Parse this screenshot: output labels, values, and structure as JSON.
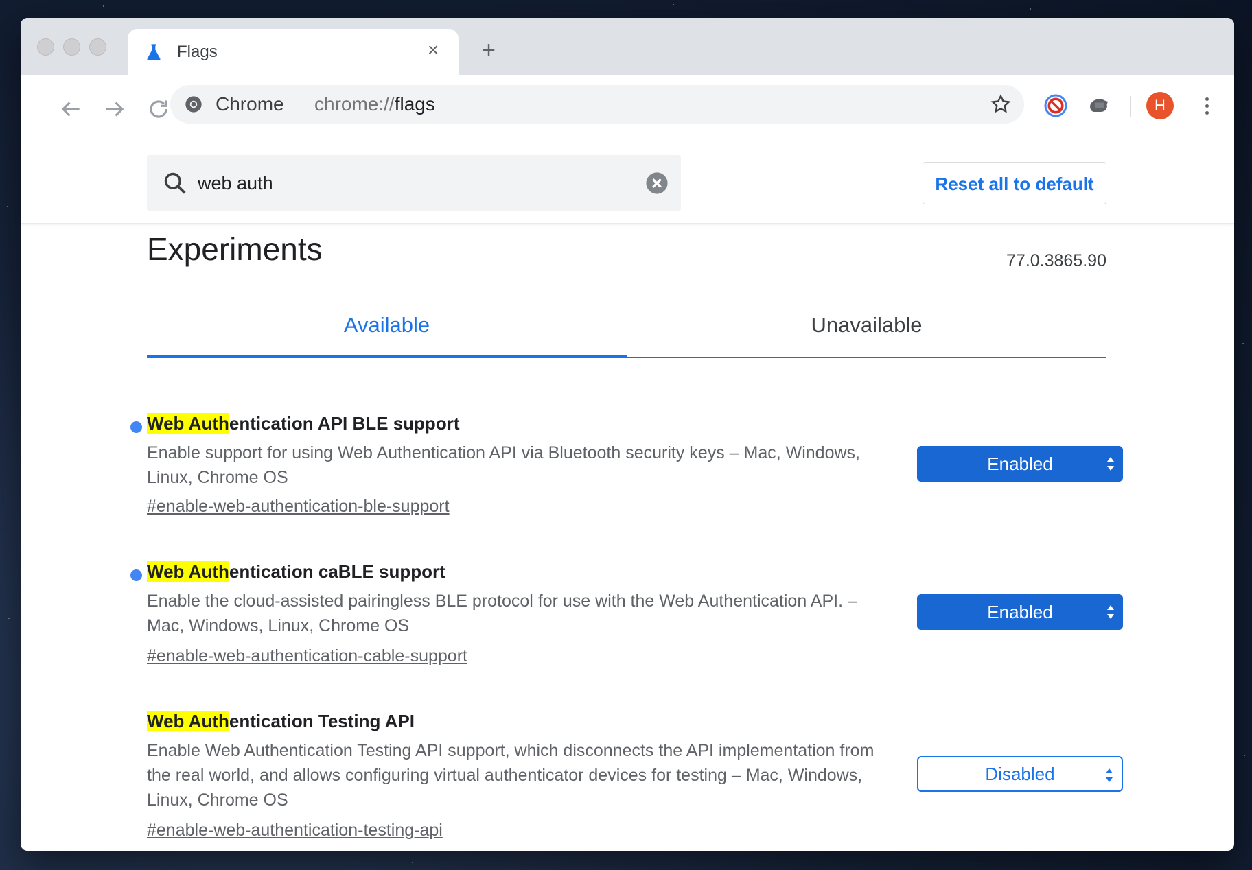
{
  "browser": {
    "tab": {
      "title": "Flags",
      "close_glyph": "×"
    },
    "new_tab_glyph": "+",
    "omnibox": {
      "chip": "Chrome",
      "url_scheme": "chrome://",
      "url_host": "flags"
    },
    "avatar_letter": "H",
    "icons": [
      "flask-icon",
      "back-arrow-icon",
      "forward-arrow-icon",
      "reload-icon",
      "chrome-logo-icon",
      "bookmark-star-icon",
      "blocked-extension-icon",
      "extension-icon",
      "kebab-menu-icon"
    ]
  },
  "search": {
    "value": "web auth"
  },
  "reset_label": "Reset all to default",
  "experiments": {
    "title": "Experiments",
    "version": "77.0.3865.90",
    "tabs": [
      {
        "label": "Available"
      },
      {
        "label": "Unavailable"
      }
    ]
  },
  "flags": [
    {
      "name_highlight": "Web Auth",
      "name_rest": "entication API BLE support",
      "description": "Enable support for using Web Authentication API via Bluetooth security keys – Mac, Windows, Linux, Chrome OS",
      "link": "#enable-web-authentication-ble-support",
      "state": "Enabled",
      "modified": true
    },
    {
      "name_highlight": "Web Auth",
      "name_rest": "entication caBLE support",
      "description": "Enable the cloud-assisted pairingless BLE protocol for use with the Web Authentication API. – Mac, Windows, Linux, Chrome OS",
      "link": "#enable-web-authentication-cable-support",
      "state": "Enabled",
      "modified": true
    },
    {
      "name_highlight": "Web Auth",
      "name_rest": "entication Testing API",
      "description": "Enable Web Authentication Testing API support, which disconnects the API implementation from the real world, and allows configuring virtual authenticator devices for testing – Mac, Windows, Linux, Chrome OS",
      "link": "#enable-web-authentication-testing-api",
      "state": "Disabled",
      "modified": false
    }
  ],
  "colors": {
    "accent": "#1a73e8",
    "highlight": "#ffff00",
    "select_enabled": "#1967d2",
    "avatar": "#e8532c"
  }
}
